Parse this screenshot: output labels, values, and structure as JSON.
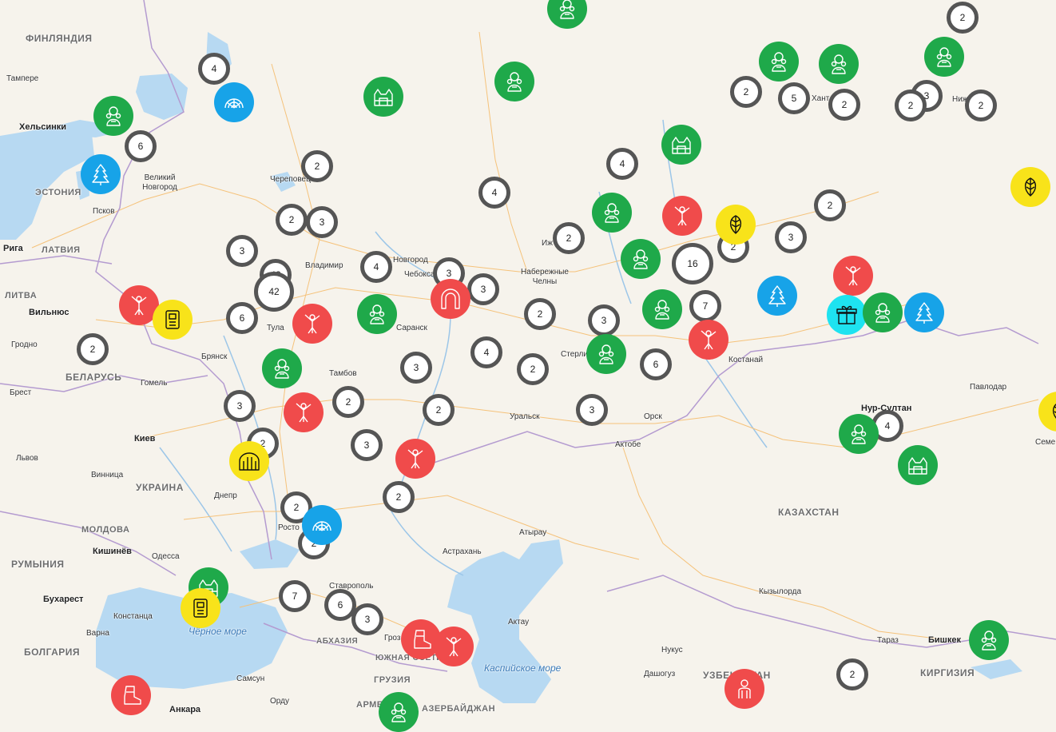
{
  "map": {
    "colors": {
      "green": "#1fa94a",
      "red": "#f04b4b",
      "blue": "#17a3e8",
      "yellow": "#f8e31a",
      "cyan": "#1ee3f0",
      "cluster_ring": "#555555",
      "water": "#b7d9f2"
    },
    "countries": [
      {
        "id": "finland",
        "name": "ФИНЛЯНДИЯ"
      },
      {
        "id": "estonia",
        "name": "ЭСТОНИЯ"
      },
      {
        "id": "latvia",
        "name": "ЛАТВИЯ"
      },
      {
        "id": "lithuania",
        "name": "ЛИТВА"
      },
      {
        "id": "belarus",
        "name": "БЕЛАРУСЬ"
      },
      {
        "id": "ukraine",
        "name": "УКРАИНА"
      },
      {
        "id": "moldova",
        "name": "МОЛДОВА"
      },
      {
        "id": "romania",
        "name": "РУМЫНИЯ"
      },
      {
        "id": "bulgaria",
        "name": "БОЛГАРИЯ"
      },
      {
        "id": "kazakhstan",
        "name": "КАЗАХСТАН"
      },
      {
        "id": "kyrgyzstan",
        "name": "КИРГИЗИЯ"
      },
      {
        "id": "georgia",
        "name": "ГРУЗИЯ"
      },
      {
        "id": "abkhazia",
        "name": "АБХАЗИЯ"
      },
      {
        "id": "south-ossetia",
        "name": "ЮЖНАЯ ОСЕТИЯ"
      },
      {
        "id": "azerbaijan",
        "name": "АЗЕРБАЙДЖАН"
      },
      {
        "id": "uzbekistan",
        "name": "УЗБЕКИСТАН"
      },
      {
        "id": "armenia",
        "name": "АРМЕН"
      }
    ],
    "seas": {
      "black_sea": "Чёрное море",
      "caspian_sea": "Каспийское море"
    },
    "cities": [
      {
        "id": "tampere",
        "name": "Тампере"
      },
      {
        "id": "helsinki",
        "name": "Хельсинки"
      },
      {
        "id": "riga",
        "name": "Рига"
      },
      {
        "id": "vilnius",
        "name": "Вильнюс"
      },
      {
        "id": "grodno",
        "name": "Гродно"
      },
      {
        "id": "brest",
        "name": "Брест"
      },
      {
        "id": "kiev",
        "name": "Киев"
      },
      {
        "id": "lviv",
        "name": "Львов"
      },
      {
        "id": "vinnitsa",
        "name": "Винница"
      },
      {
        "id": "kishinev",
        "name": "Кишинёв"
      },
      {
        "id": "odessa",
        "name": "Одесса"
      },
      {
        "id": "bucharest",
        "name": "Бухарест"
      },
      {
        "id": "constanta",
        "name": "Констанца"
      },
      {
        "id": "varna",
        "name": "Варна"
      },
      {
        "id": "ankara",
        "name": "Анкара"
      },
      {
        "id": "samsun",
        "name": "Самсун"
      },
      {
        "id": "ordu",
        "name": "Орду"
      },
      {
        "id": "pskov",
        "name": "Псков"
      },
      {
        "id": "velikiy-novgorod",
        "name": "Великий Новгород"
      },
      {
        "id": "cherepovets",
        "name": "Череповец"
      },
      {
        "id": "vladimir",
        "name": "Владимир"
      },
      {
        "id": "tula",
        "name": "Тула"
      },
      {
        "id": "bryansk",
        "name": "Брянск"
      },
      {
        "id": "gomel",
        "name": "Гомель"
      },
      {
        "id": "tambov",
        "name": "Тамбов"
      },
      {
        "id": "saransk",
        "name": "Саранск"
      },
      {
        "id": "cheboksary",
        "name": "Чебоксары"
      },
      {
        "id": "nizhny-novgorod",
        "name": "Новгород"
      },
      {
        "id": "naberezhnye-chelny",
        "name": "Набережные Челны"
      },
      {
        "id": "sterlitamak",
        "name": "Стерлитамак"
      },
      {
        "id": "uralsk",
        "name": "Уральск"
      },
      {
        "id": "orsk",
        "name": "Орск"
      },
      {
        "id": "aktobe",
        "name": "Актобе"
      },
      {
        "id": "kostanay",
        "name": "Костанай"
      },
      {
        "id": "pavlodar",
        "name": "Павлодар"
      },
      {
        "id": "nur-sultan",
        "name": "Нур-Султан"
      },
      {
        "id": "atyrau",
        "name": "Атырау"
      },
      {
        "id": "astrakhan",
        "name": "Астрахань"
      },
      {
        "id": "aktau",
        "name": "Актау"
      },
      {
        "id": "stavropol",
        "name": "Ставрополь"
      },
      {
        "id": "kyzylorda",
        "name": "Кызылорда"
      },
      {
        "id": "nukus",
        "name": "Нукус"
      },
      {
        "id": "dashoguz",
        "name": "Дашогуз"
      },
      {
        "id": "taraz",
        "name": "Тараз"
      },
      {
        "id": "bishkek",
        "name": "Бишкек"
      },
      {
        "id": "dnepr",
        "name": "Днепр"
      },
      {
        "id": "rostov",
        "name": "Росто"
      },
      {
        "id": "semey",
        "name": "Семе"
      },
      {
        "id": "grozny",
        "name": "Гроз"
      },
      {
        "id": "izhevsk",
        "name": "Иж"
      },
      {
        "id": "khanty",
        "name": "Хант"
      },
      {
        "id": "nizhnevartovsk",
        "name": "Ниж"
      }
    ],
    "clusters": [
      "4",
      "2",
      "6",
      "2",
      "2",
      "3",
      "3",
      "42",
      "6",
      "2",
      "4",
      "3",
      "3",
      "2",
      "3",
      "2",
      "3",
      "2",
      "3",
      "2",
      "4",
      "2",
      "2",
      "4",
      "3",
      "2",
      "7",
      "6",
      "3",
      "4",
      "2",
      "16",
      "6",
      "7",
      "2",
      "2",
      "5",
      "2",
      "3",
      "2",
      "2",
      "3",
      "3",
      "2",
      "2",
      "2",
      "4"
    ],
    "pins": [
      {
        "color": "green",
        "icon": "mascot-icon"
      },
      {
        "color": "blue",
        "icon": "rainbow-icon"
      },
      {
        "color": "green",
        "icon": "mascot-icon"
      },
      {
        "color": "blue",
        "icon": "fir-tree-icon"
      },
      {
        "color": "green",
        "icon": "bounce-house-icon"
      },
      {
        "color": "green",
        "icon": "mascot-icon"
      },
      {
        "color": "green",
        "icon": "mascot-icon"
      },
      {
        "color": "red",
        "icon": "air-dancer-icon"
      },
      {
        "color": "yellow",
        "icon": "dispenser-icon"
      },
      {
        "color": "red",
        "icon": "air-dancer-icon"
      },
      {
        "color": "green",
        "icon": "mascot-icon"
      },
      {
        "color": "green",
        "icon": "mascot-icon"
      },
      {
        "color": "red",
        "icon": "air-dancer-icon"
      },
      {
        "color": "red",
        "icon": "arch-icon"
      },
      {
        "color": "red",
        "icon": "air-dancer-icon"
      },
      {
        "color": "yellow",
        "icon": "tunnel-icon"
      },
      {
        "color": "blue",
        "icon": "rainbow-icon"
      },
      {
        "color": "green",
        "icon": "bounce-house-icon"
      },
      {
        "color": "yellow",
        "icon": "dispenser-icon"
      },
      {
        "color": "red",
        "icon": "boot-icon"
      },
      {
        "color": "red",
        "icon": "air-dancer-icon"
      },
      {
        "color": "red",
        "icon": "boot-icon"
      },
      {
        "color": "green",
        "icon": "mascot-icon"
      },
      {
        "color": "green",
        "icon": "mascot-icon"
      },
      {
        "color": "green",
        "icon": "mascot-icon"
      },
      {
        "color": "green",
        "icon": "mascot-icon"
      },
      {
        "color": "green",
        "icon": "mascot-icon"
      },
      {
        "color": "green",
        "icon": "bounce-house-icon"
      },
      {
        "color": "red",
        "icon": "air-dancer-icon"
      },
      {
        "color": "yellow",
        "icon": "leaves-icon"
      },
      {
        "color": "red",
        "icon": "air-dancer-icon"
      },
      {
        "color": "blue",
        "icon": "fir-tree-icon"
      },
      {
        "color": "red",
        "icon": "air-dancer-icon"
      },
      {
        "color": "cyan",
        "icon": "gift-box-icon"
      },
      {
        "color": "green",
        "icon": "mascot-icon"
      },
      {
        "color": "blue",
        "icon": "fir-tree-icon"
      },
      {
        "color": "green",
        "icon": "mascot-icon"
      },
      {
        "color": "green",
        "icon": "bounce-house-icon"
      },
      {
        "color": "green",
        "icon": "mascot-icon"
      },
      {
        "color": "red",
        "icon": "person-icon"
      },
      {
        "color": "yellow",
        "icon": "leaves-icon"
      },
      {
        "color": "green",
        "icon": "mascot-icon"
      },
      {
        "color": "green",
        "icon": "mascot-icon"
      },
      {
        "color": "yellow",
        "icon": "leaves-icon"
      }
    ]
  }
}
